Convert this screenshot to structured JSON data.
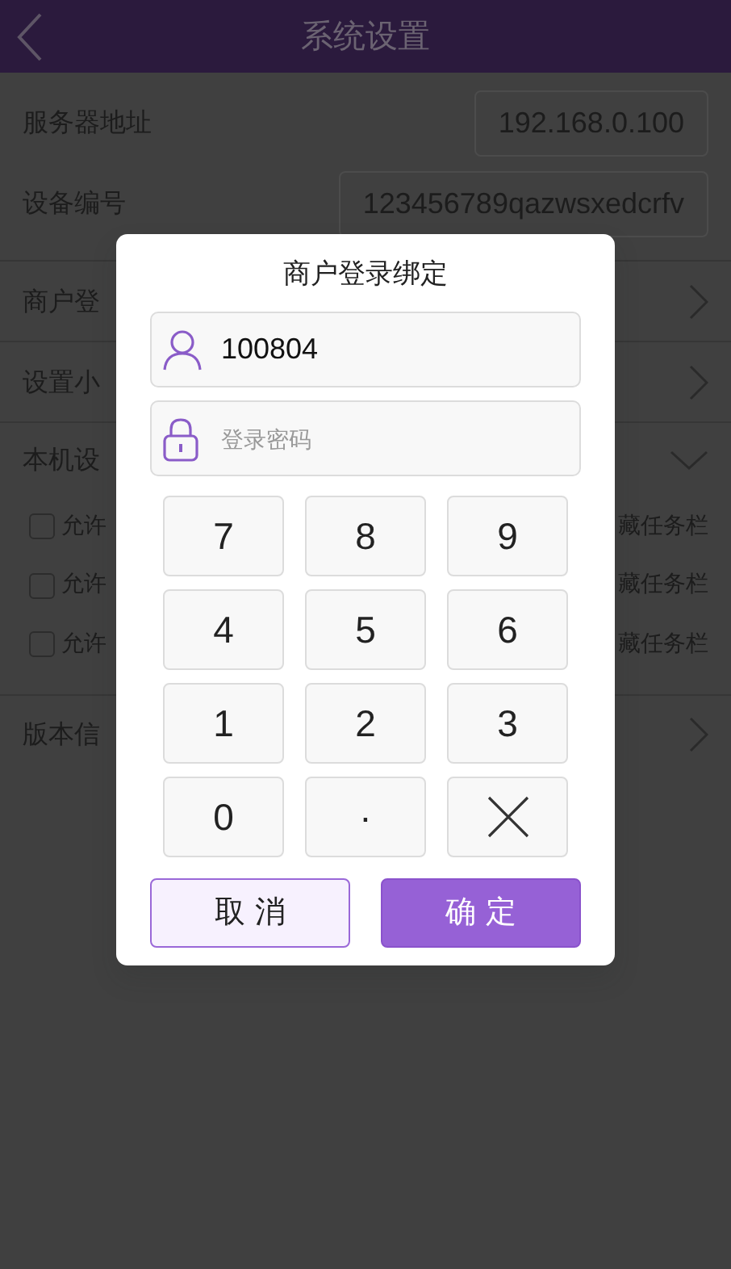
{
  "header": {
    "title": "系统设置"
  },
  "settings": [
    {
      "kind": "field",
      "label": "服务器地址",
      "value": "192.168.0.100"
    },
    {
      "kind": "field",
      "label": "设备编号",
      "value": "123456789qazwsxedcrfv"
    },
    {
      "kind": "link",
      "label": "商户登"
    },
    {
      "kind": "link",
      "label": "设置小"
    },
    {
      "kind": "group",
      "label": "本机设",
      "expanded": true,
      "options": [
        {
          "left": "允许",
          "right": "藏任务栏",
          "checked": false
        },
        {
          "left": "允许",
          "right": "藏任务栏",
          "checked": false
        },
        {
          "left": "允许",
          "right": "藏任务栏",
          "checked": false
        }
      ]
    },
    {
      "kind": "link",
      "label": "版本信"
    }
  ],
  "dialog": {
    "title": "商户登录绑定",
    "username": {
      "value": "100804"
    },
    "password": {
      "placeholder": "登录密码"
    },
    "keys": [
      {
        "kind": "digit",
        "label": "7"
      },
      {
        "kind": "digit",
        "label": "8"
      },
      {
        "kind": "digit",
        "label": "9"
      },
      {
        "kind": "digit",
        "label": "4"
      },
      {
        "kind": "digit",
        "label": "5"
      },
      {
        "kind": "digit",
        "label": "6"
      },
      {
        "kind": "digit",
        "label": "1"
      },
      {
        "kind": "digit",
        "label": "2"
      },
      {
        "kind": "digit",
        "label": "3"
      },
      {
        "kind": "digit",
        "label": "0"
      },
      {
        "kind": "digit",
        "label": "·"
      },
      {
        "kind": "delete"
      }
    ],
    "buttons": [
      {
        "kind": "secondary",
        "label": "取 消"
      },
      {
        "kind": "primary",
        "label": "确 定"
      }
    ]
  }
}
